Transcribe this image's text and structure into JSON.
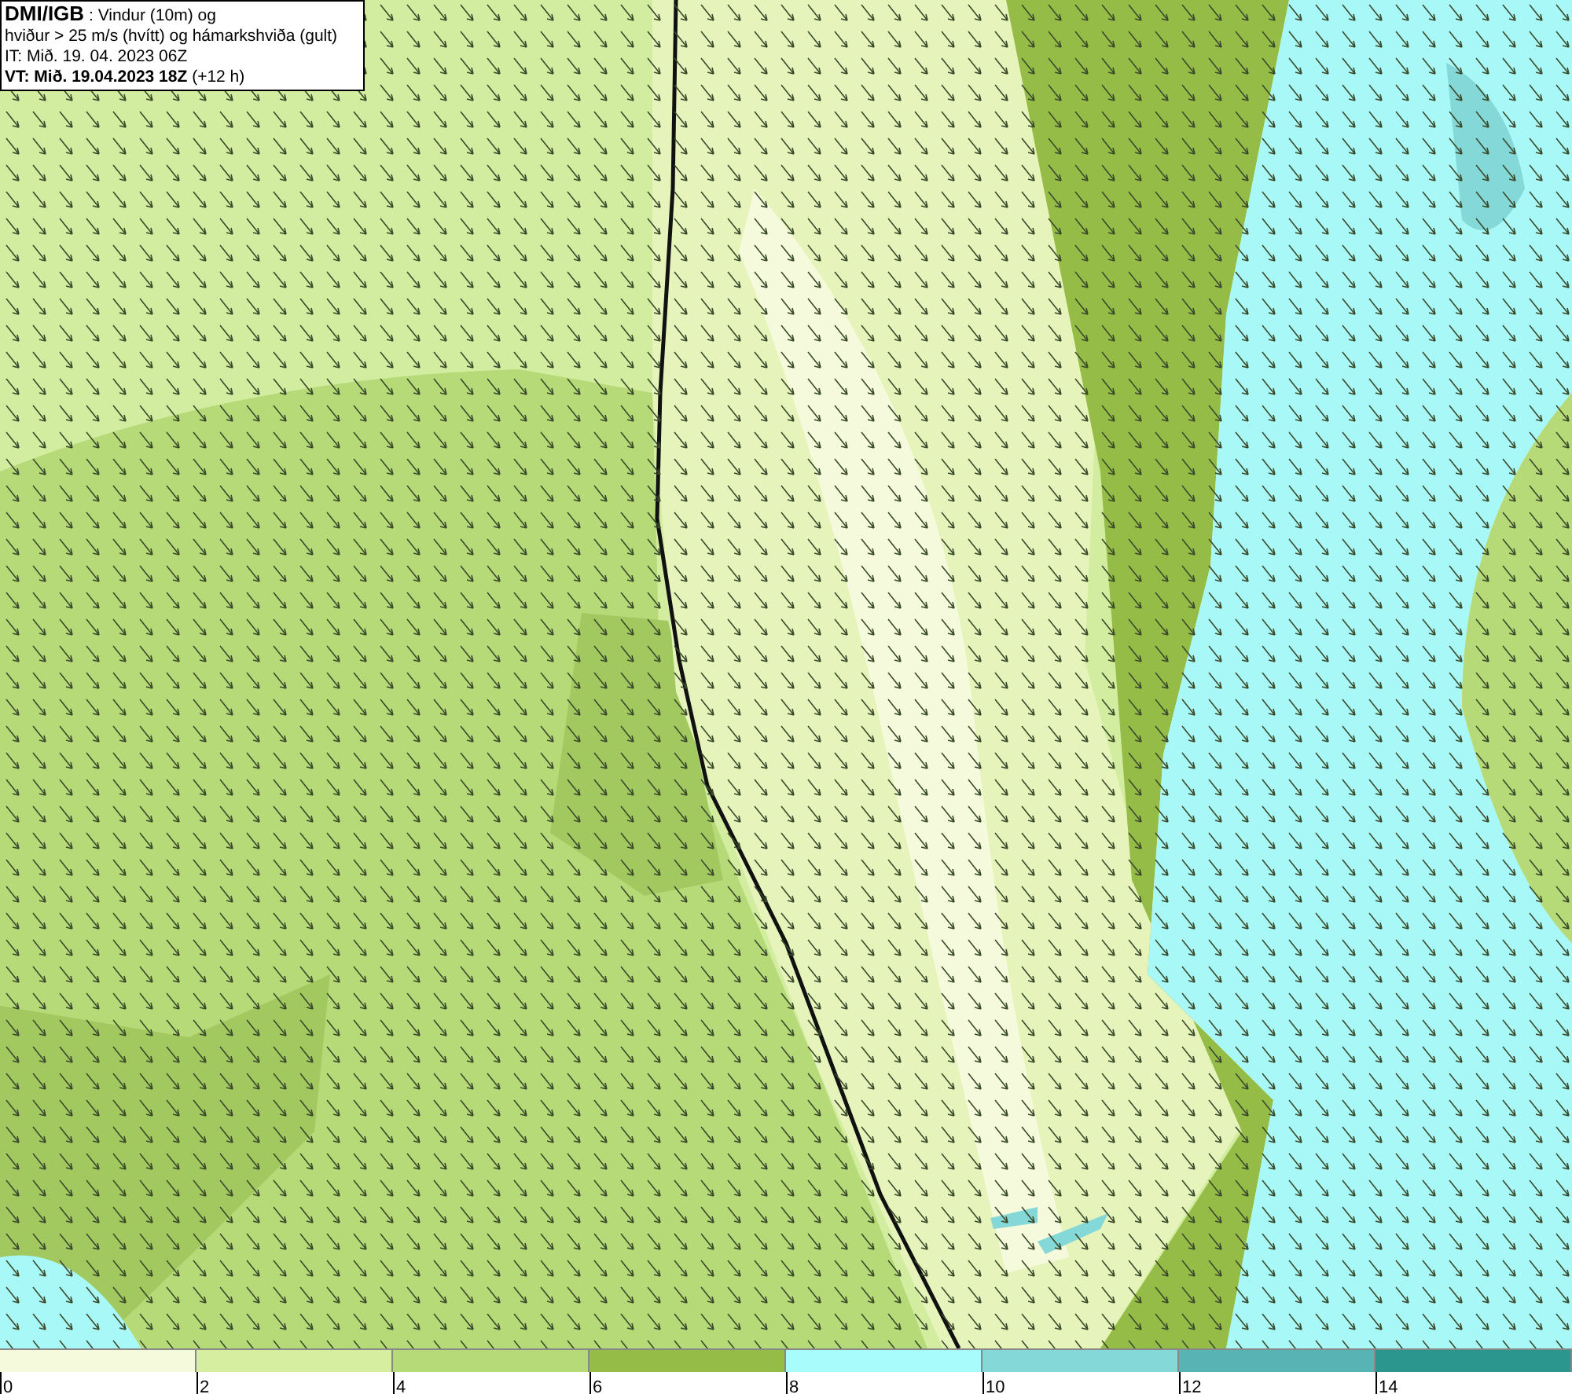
{
  "header": {
    "lines": [
      "**DMI/IGB** : Vindur (10m) og",
      "hviður > 25 m/s (hvítt) og hámarkshviða (gult)",
      "IT: Mið. 19. 04. 2023 06Z",
      "**VT: Mið. 19.04.2023 18Z** (+12 h)"
    ]
  },
  "legend": {
    "bins": [
      {
        "label": "0",
        "color": "#f5fadc"
      },
      {
        "label": "2",
        "color": "#d6eea0"
      },
      {
        "label": "4",
        "color": "#b6da78"
      },
      {
        "label": "6",
        "color": "#96bc48"
      },
      {
        "label": "8",
        "color": "#a8fcfc"
      },
      {
        "label": "10",
        "color": "#84d8d8"
      },
      {
        "label": "12",
        "color": "#58b4b4"
      },
      {
        "label": "14",
        "color": "#2a968e"
      }
    ]
  }
}
